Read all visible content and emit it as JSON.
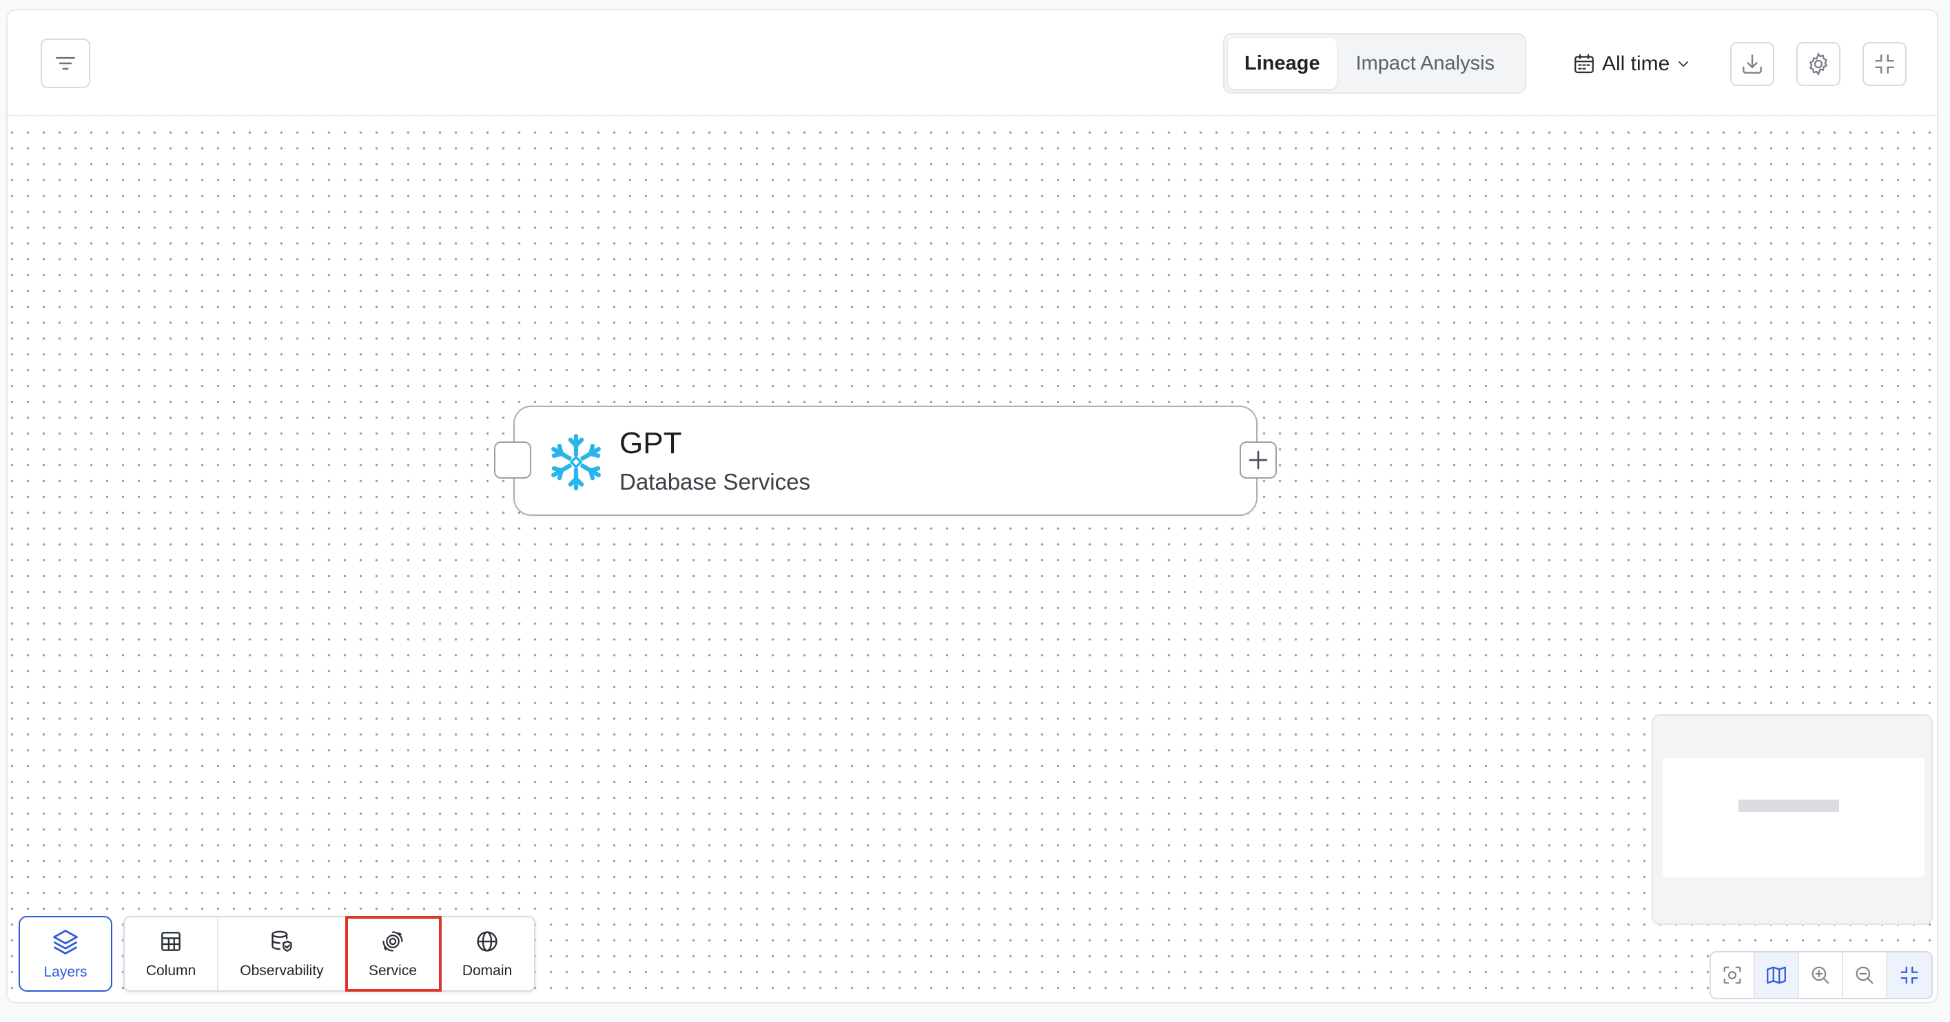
{
  "toolbar": {
    "filter_icon": "filter-lines-icon",
    "tabs": [
      {
        "label": "Lineage",
        "active": true
      },
      {
        "label": "Impact Analysis",
        "active": false
      }
    ],
    "time_filter": {
      "icon": "calendar-icon",
      "label": "All time"
    },
    "download_icon": "download-icon",
    "settings_icon": "gear-icon",
    "exit_fullscreen_icon": "collapse-icon"
  },
  "node": {
    "title": "GPT",
    "subtitle": "Database Services",
    "logo": "snowflake-logo",
    "logo_color": "#29B5E8"
  },
  "layers": {
    "label": "Layers",
    "items": [
      {
        "label": "Column",
        "icon": "table-icon"
      },
      {
        "label": "Observability",
        "icon": "database-check-icon"
      },
      {
        "label": "Service",
        "icon": "service-icon",
        "selected": true
      },
      {
        "label": "Domain",
        "icon": "globe-icon"
      }
    ]
  },
  "controls": {
    "items": [
      "fit-view-icon",
      "map-icon",
      "zoom-in-icon",
      "zoom-out-icon",
      "fullscreen-icon"
    ],
    "active": "map-icon"
  },
  "colors": {
    "accent": "#2f5bd8",
    "selection_outline": "#e0352b",
    "snowflake": "#29B5E8"
  }
}
